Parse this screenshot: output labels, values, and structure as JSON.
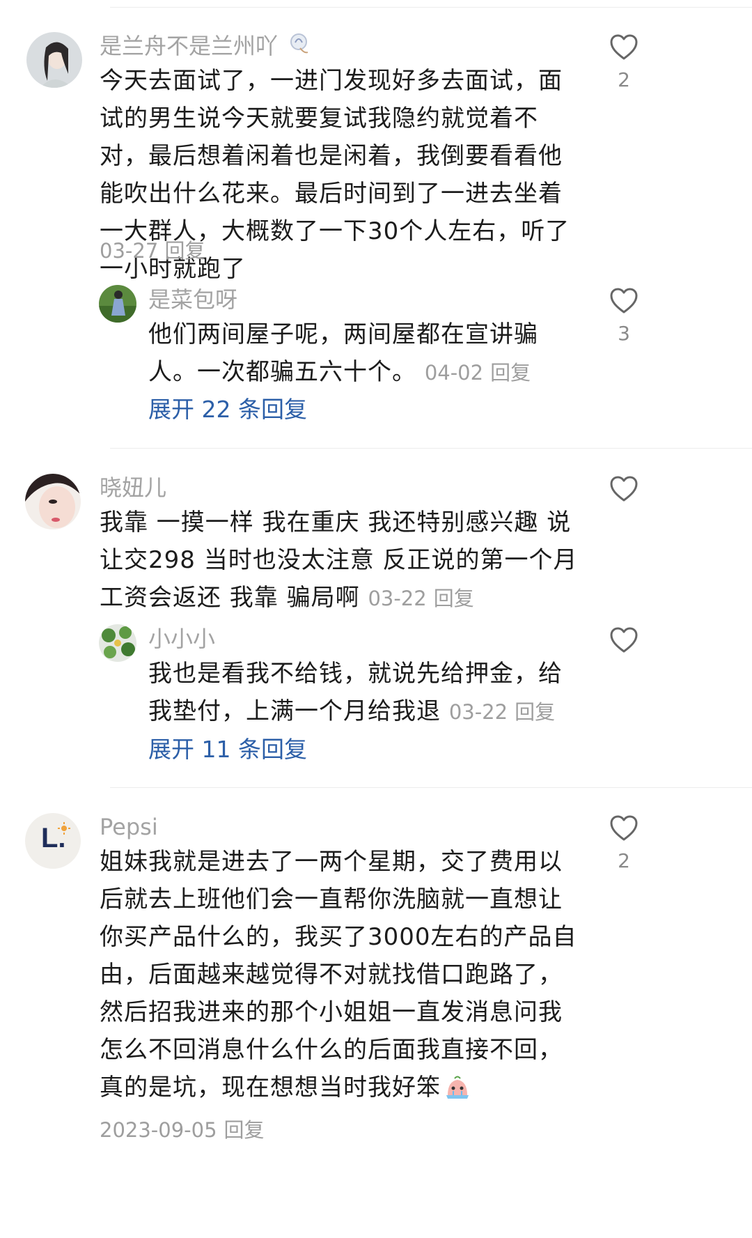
{
  "comments": [
    {
      "user": "是兰舟不是兰州吖",
      "text": "今天去面试了，一进门发现好多去面试，面试的男生说今天就要复试我隐约就觉着不对，最后想着闲着也是闲着，我倒要看看他能吹出什么花来。最后时间到了一进去坐着一大群人，大概数了一下30个人左右，听了一小时就跑了",
      "date": "03-27",
      "reply_label": "回复",
      "likes": "2",
      "reply": {
        "user": "是菜包呀",
        "text": "他们两间屋子呢，两间屋都在宣讲骗人。一次都骗五六十个。",
        "date": "04-02",
        "reply_label": "回复",
        "likes": "3"
      },
      "expand_label": "展开 22 条回复"
    },
    {
      "user": "晓妞儿",
      "text": "我靠  一摸一样  我在重庆  我还特别感兴趣  说让交298 当时也没太注意  反正说的第一个月工资会返还  我靠  骗局啊",
      "date": "03-22",
      "reply_label": "回复",
      "likes": "",
      "reply": {
        "user": "小小小",
        "text": "我也是看我不给钱，就说先给押金，给我垫付，上满一个月给我退",
        "date": "03-22",
        "reply_label": "回复",
        "likes": ""
      },
      "expand_label": "展开 11 条回复"
    },
    {
      "user": "Pepsi",
      "avatar_letter": "L.",
      "text": "姐妹我就是进去了一两个星期，交了费用以后就去上班他们会一直帮你洗脑就一直想让你买产品什么的，我买了3000左右的产品自由，后面越来越觉得不对就找借口跑路了，然后招我进来的那个小姐姐一直发消息问我怎么不回消息什么什么的后面我直接不回，真的是坑，现在想想当时我好笨",
      "date": "2023-09-05",
      "reply_label": "回复",
      "likes": "2"
    }
  ],
  "colors": {
    "link": "#2c5fa8",
    "meta": "#9e9e9e",
    "name": "#a3a3a3"
  },
  "icons": [
    "heart-outline-icon",
    "badge-icon",
    "crying-emoji-icon"
  ]
}
